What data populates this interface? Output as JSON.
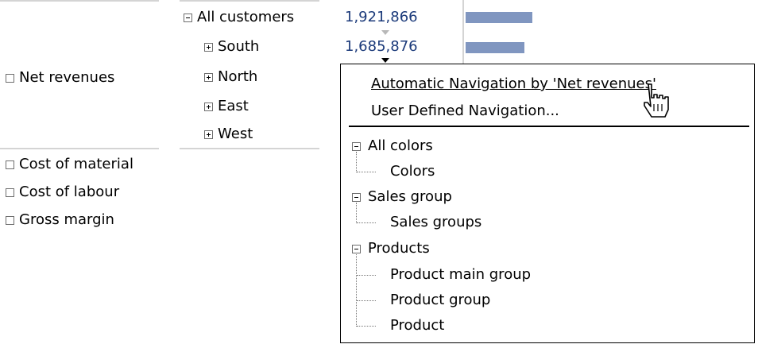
{
  "rows": {
    "net_revenues": "Net revenues",
    "cost_of_material": "Cost of material",
    "cost_of_labour": "Cost of labour",
    "gross_margin": "Gross margin"
  },
  "customers": {
    "all": "All customers",
    "south": "South",
    "north": "North",
    "east": "East",
    "west": "West"
  },
  "values": {
    "all": "1,921,866",
    "south": "1,685,876"
  },
  "bars": {
    "all_fraction": 1.0,
    "south_fraction": 0.88
  },
  "popup": {
    "auto_nav": "Automatic Navigation by 'Net revenues'",
    "user_nav": "User Defined Navigation...",
    "tree": {
      "all_colors": "All colors",
      "colors": "Colors",
      "sales_group": "Sales group",
      "sales_groups": "Sales groups",
      "products": "Products",
      "product_main_group": "Product main group",
      "product_group": "Product group",
      "product": "Product"
    }
  },
  "colors": {
    "value_text": "#1b3a7a",
    "bar": "#8096c0"
  },
  "icons": [
    "expand-icon",
    "collapse-icon",
    "hand-cursor-icon",
    "dropdown-triangle-icon"
  ]
}
